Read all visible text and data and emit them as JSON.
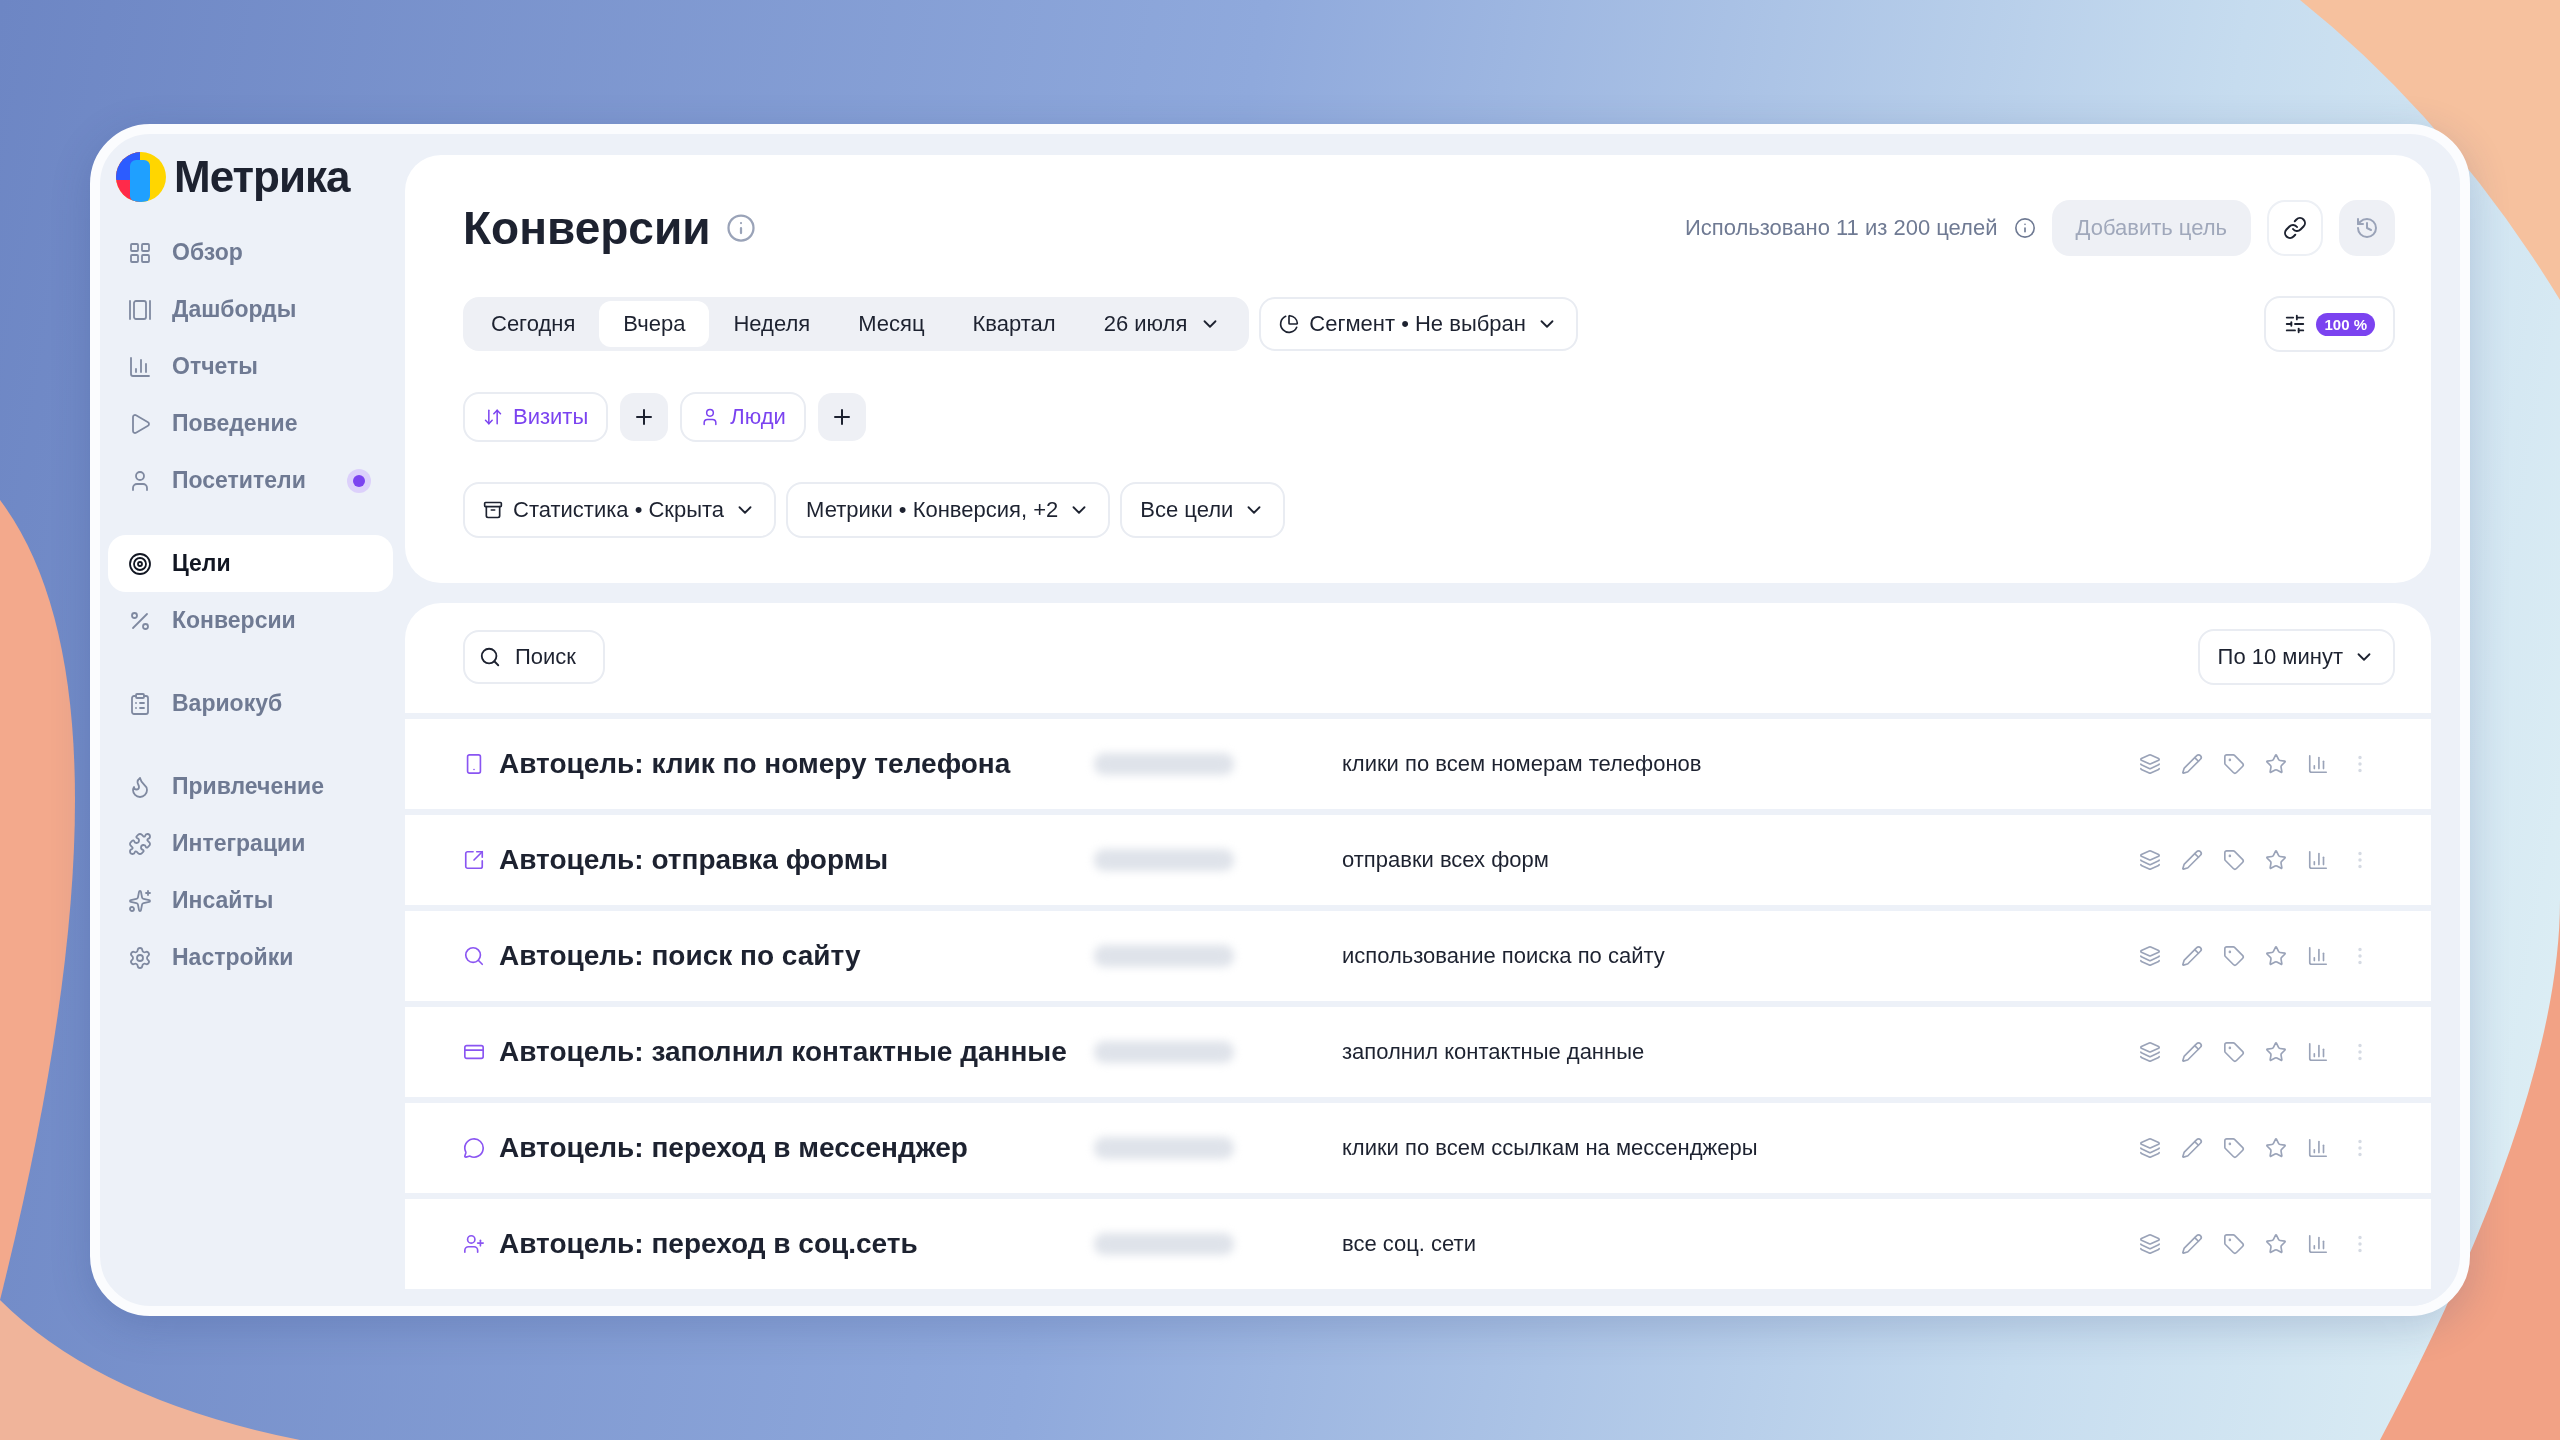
{
  "logo": {
    "text": "Метрика"
  },
  "sidebar": {
    "groups": [
      {
        "items": [
          {
            "label": "Обзор",
            "selected": false,
            "notification": false
          },
          {
            "label": "Дашборды",
            "selected": false,
            "notification": false
          },
          {
            "label": "Отчеты",
            "selected": false,
            "notification": false
          },
          {
            "label": "Поведение",
            "selected": false,
            "notification": false
          },
          {
            "label": "Посетители",
            "selected": false,
            "notification": true
          }
        ]
      },
      {
        "items": [
          {
            "label": "Цели",
            "selected": true,
            "notification": false
          },
          {
            "label": "Конверсии",
            "selected": false,
            "notification": false
          }
        ]
      },
      {
        "items": [
          {
            "label": "Вариокуб",
            "selected": false,
            "notification": false
          }
        ]
      },
      {
        "items": [
          {
            "label": "Привлечение",
            "selected": false,
            "notification": false
          },
          {
            "label": "Интеграции",
            "selected": false,
            "notification": false
          },
          {
            "label": "Инсайты",
            "selected": false,
            "notification": false
          },
          {
            "label": "Настройки",
            "selected": false,
            "notification": false
          }
        ]
      }
    ]
  },
  "header": {
    "title": "Конверсии",
    "usage": "Использовано 11 из 200 целей",
    "add_button": {
      "label": "Добавить цель",
      "disabled": true
    }
  },
  "periods": [
    {
      "label": "Сегодня",
      "selected": false
    },
    {
      "label": "Вчера",
      "selected": true
    },
    {
      "label": "Неделя",
      "selected": false
    },
    {
      "label": "Месяц",
      "selected": false
    },
    {
      "label": "Квартал",
      "selected": false
    }
  ],
  "date_picker": "26 июля",
  "segment": "Сегмент • Не выбран",
  "sampling": "100 %",
  "chips": [
    "Визиты",
    "Люди"
  ],
  "filters": [
    "Статистика • Скрыта",
    "Метрики • Конверсия, +2",
    "Все цели"
  ],
  "search": {
    "placeholder": "Поиск"
  },
  "grouping": "По 10 минут",
  "goals": [
    {
      "name": "Автоцель: клик по номеру телефона",
      "description": "клики по всем номерам телефонов"
    },
    {
      "name": "Автоцель: отправка формы",
      "description": "отправки всех форм"
    },
    {
      "name": "Автоцель: поиск по сайту",
      "description": "использование поиска по сайту"
    },
    {
      "name": "Автоцель: заполнил контактные данные",
      "description": "заполнил контактные данные"
    },
    {
      "name": "Автоцель: переход в мессенджер",
      "description": "клики по всем ссылкам на мессенджеры"
    },
    {
      "name": "Автоцель: переход в соц.сеть",
      "description": "все соц. сети"
    }
  ]
}
